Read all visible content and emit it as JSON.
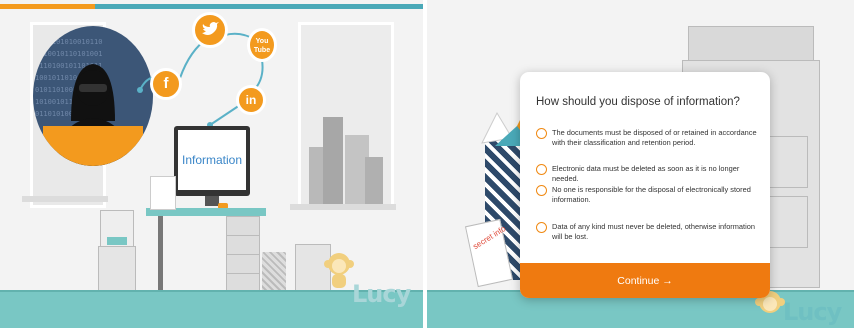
{
  "left_panel": {
    "monitor_label": "Information",
    "social_icons": [
      "twitter-icon",
      "facebook-icon",
      "youtube-icon",
      "linkedin-icon"
    ],
    "social_text": {
      "facebook": "f",
      "youtube_top": "You",
      "youtube_bottom": "Tube",
      "linkedin": "in"
    },
    "mascot_label": "Lucy",
    "colors": {
      "accent": "#f39a1e",
      "floor": "#79c7c4",
      "progress_teal": "#4aa9b8",
      "progress_orange": "#f39a1e"
    }
  },
  "right_panel": {
    "trash_note": "secret info",
    "mascot_label": "Lucy"
  },
  "quiz": {
    "question": "How should you dispose of information?",
    "options": [
      "The documents must be disposed of or retained in accordance with their classification and retention period.",
      "Electronic data must be deleted as soon as it is no longer needed.",
      "No one is responsible for the disposal of electronically stored information.",
      "Data of any kind must never be deleted, otherwise information will be lost."
    ],
    "continue_label": "Continue →",
    "colors": {
      "button": "#ef7a10",
      "radio": "#f08a14"
    }
  }
}
